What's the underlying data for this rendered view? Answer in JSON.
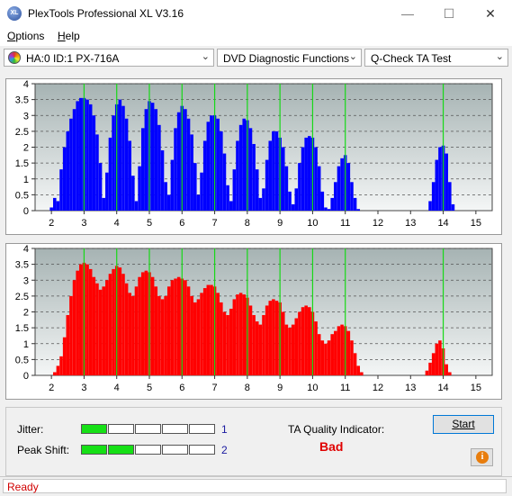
{
  "window": {
    "title": "PlexTools Professional XL V3.16",
    "icon_text": "XL",
    "minimize_glyph": "—",
    "maximize_glyph": "☐",
    "close_glyph": "✕"
  },
  "menu": [
    {
      "label": "Options",
      "accel": "O"
    },
    {
      "label": "Help",
      "accel": "H"
    }
  ],
  "toolbar": {
    "drive": "HA:0 ID:1  PX-716A",
    "function": "DVD Diagnostic Functions",
    "test": "Q-Check TA Test",
    "dropdown_glyph": "⌄"
  },
  "colors": {
    "top_series": "#0000ff",
    "bottom_series": "#ff0000",
    "marker": "#18d818",
    "status": "#d00000",
    "bad": "#e00000"
  },
  "chart_data": [
    {
      "type": "bar",
      "name": "top-chart",
      "xlim": [
        1.5,
        15.5
      ],
      "ylim": [
        0,
        4
      ],
      "x_ticks": [
        2,
        3,
        4,
        5,
        6,
        7,
        8,
        9,
        10,
        11,
        12,
        13,
        14,
        15
      ],
      "y_ticks": [
        0,
        0.5,
        1,
        1.5,
        2,
        2.5,
        3,
        3.5,
        4
      ],
      "y_tick_labels": [
        "0",
        "0.5",
        "1",
        "1.5",
        "2",
        "2.5",
        "3",
        "3.5",
        "4"
      ],
      "markers": [
        3,
        4,
        5,
        6,
        7,
        8,
        9,
        10,
        11,
        14
      ],
      "series": [
        {
          "color": "blue",
          "values": [
            [
              2.0,
              0.1
            ],
            [
              2.1,
              0.4
            ],
            [
              2.2,
              0.3
            ],
            [
              2.3,
              1.3
            ],
            [
              2.4,
              2.0
            ],
            [
              2.5,
              2.5
            ],
            [
              2.6,
              2.9
            ],
            [
              2.7,
              3.2
            ],
            [
              2.8,
              3.45
            ],
            [
              2.9,
              3.55
            ],
            [
              3.0,
              3.55
            ],
            [
              3.1,
              3.5
            ],
            [
              3.2,
              3.35
            ],
            [
              3.3,
              3.0
            ],
            [
              3.4,
              2.4
            ],
            [
              3.5,
              1.5
            ],
            [
              3.6,
              0.4
            ],
            [
              3.7,
              1.2
            ],
            [
              3.8,
              2.3
            ],
            [
              3.9,
              3.0
            ],
            [
              4.0,
              3.35
            ],
            [
              4.1,
              3.5
            ],
            [
              4.2,
              3.3
            ],
            [
              4.3,
              2.9
            ],
            [
              4.4,
              2.2
            ],
            [
              4.5,
              1.1
            ],
            [
              4.6,
              0.3
            ],
            [
              4.7,
              1.4
            ],
            [
              4.8,
              2.6
            ],
            [
              4.9,
              3.2
            ],
            [
              5.0,
              3.45
            ],
            [
              5.1,
              3.4
            ],
            [
              5.2,
              3.2
            ],
            [
              5.3,
              2.7
            ],
            [
              5.4,
              1.9
            ],
            [
              5.5,
              0.9
            ],
            [
              5.6,
              0.5
            ],
            [
              5.7,
              1.6
            ],
            [
              5.8,
              2.6
            ],
            [
              5.9,
              3.1
            ],
            [
              6.0,
              3.3
            ],
            [
              6.1,
              3.2
            ],
            [
              6.2,
              2.9
            ],
            [
              6.3,
              2.4
            ],
            [
              6.4,
              1.5
            ],
            [
              6.5,
              0.5
            ],
            [
              6.6,
              1.2
            ],
            [
              6.7,
              2.2
            ],
            [
              6.8,
              2.8
            ],
            [
              6.9,
              3.0
            ],
            [
              7.0,
              3.0
            ],
            [
              7.1,
              2.9
            ],
            [
              7.2,
              2.5
            ],
            [
              7.3,
              1.8
            ],
            [
              7.4,
              0.8
            ],
            [
              7.5,
              0.3
            ],
            [
              7.6,
              1.3
            ],
            [
              7.7,
              2.2
            ],
            [
              7.8,
              2.7
            ],
            [
              7.9,
              2.9
            ],
            [
              8.0,
              2.85
            ],
            [
              8.1,
              2.6
            ],
            [
              8.2,
              2.1
            ],
            [
              8.3,
              1.3
            ],
            [
              8.4,
              0.4
            ],
            [
              8.5,
              0.7
            ],
            [
              8.6,
              1.6
            ],
            [
              8.7,
              2.2
            ],
            [
              8.8,
              2.5
            ],
            [
              8.9,
              2.5
            ],
            [
              9.0,
              2.3
            ],
            [
              9.1,
              2.0
            ],
            [
              9.2,
              1.4
            ],
            [
              9.3,
              0.6
            ],
            [
              9.4,
              0.2
            ],
            [
              9.5,
              0.7
            ],
            [
              9.6,
              1.5
            ],
            [
              9.7,
              2.0
            ],
            [
              9.8,
              2.3
            ],
            [
              9.9,
              2.35
            ],
            [
              10.0,
              2.3
            ],
            [
              10.1,
              2.0
            ],
            [
              10.2,
              1.4
            ],
            [
              10.3,
              0.6
            ],
            [
              10.4,
              0.1
            ],
            [
              10.5,
              0.05
            ],
            [
              10.6,
              0.4
            ],
            [
              10.7,
              0.9
            ],
            [
              10.8,
              1.4
            ],
            [
              10.9,
              1.65
            ],
            [
              11.0,
              1.75
            ],
            [
              11.1,
              1.5
            ],
            [
              11.2,
              0.9
            ],
            [
              11.3,
              0.4
            ],
            [
              11.4,
              0.05
            ],
            [
              13.6,
              0.3
            ],
            [
              13.7,
              0.9
            ],
            [
              13.8,
              1.6
            ],
            [
              13.9,
              2.0
            ],
            [
              14.0,
              2.05
            ],
            [
              14.1,
              1.8
            ],
            [
              14.2,
              0.9
            ],
            [
              14.3,
              0.2
            ]
          ]
        }
      ]
    },
    {
      "type": "bar",
      "name": "bottom-chart",
      "xlim": [
        1.5,
        15.5
      ],
      "ylim": [
        0,
        4
      ],
      "x_ticks": [
        2,
        3,
        4,
        5,
        6,
        7,
        8,
        9,
        10,
        11,
        12,
        13,
        14,
        15
      ],
      "y_ticks": [
        0,
        0.5,
        1,
        1.5,
        2,
        2.5,
        3,
        3.5,
        4
      ],
      "y_tick_labels": [
        "0",
        "0.5",
        "1",
        "1.5",
        "2",
        "2.5",
        "3",
        "3.5",
        "4"
      ],
      "markers": [
        3,
        4,
        5,
        6,
        7,
        8,
        9,
        10,
        11,
        14
      ],
      "series": [
        {
          "color": "red",
          "values": [
            [
              2.1,
              0.1
            ],
            [
              2.2,
              0.3
            ],
            [
              2.3,
              0.6
            ],
            [
              2.4,
              1.2
            ],
            [
              2.5,
              1.9
            ],
            [
              2.6,
              2.5
            ],
            [
              2.7,
              3.0
            ],
            [
              2.8,
              3.3
            ],
            [
              2.9,
              3.5
            ],
            [
              3.0,
              3.55
            ],
            [
              3.1,
              3.5
            ],
            [
              3.2,
              3.35
            ],
            [
              3.3,
              3.1
            ],
            [
              3.4,
              2.9
            ],
            [
              3.5,
              2.7
            ],
            [
              3.6,
              2.8
            ],
            [
              3.7,
              3.0
            ],
            [
              3.8,
              3.2
            ],
            [
              3.9,
              3.35
            ],
            [
              4.0,
              3.45
            ],
            [
              4.1,
              3.4
            ],
            [
              4.2,
              3.2
            ],
            [
              4.3,
              2.9
            ],
            [
              4.4,
              2.6
            ],
            [
              4.5,
              2.5
            ],
            [
              4.6,
              2.8
            ],
            [
              4.7,
              3.1
            ],
            [
              4.8,
              3.25
            ],
            [
              4.9,
              3.3
            ],
            [
              5.0,
              3.25
            ],
            [
              5.1,
              3.1
            ],
            [
              5.2,
              2.8
            ],
            [
              5.3,
              2.5
            ],
            [
              5.4,
              2.4
            ],
            [
              5.5,
              2.5
            ],
            [
              5.6,
              2.8
            ],
            [
              5.7,
              3.0
            ],
            [
              5.8,
              3.05
            ],
            [
              5.9,
              3.1
            ],
            [
              6.0,
              3.05
            ],
            [
              6.1,
              3.0
            ],
            [
              6.2,
              2.8
            ],
            [
              6.3,
              2.5
            ],
            [
              6.4,
              2.3
            ],
            [
              6.5,
              2.4
            ],
            [
              6.6,
              2.6
            ],
            [
              6.7,
              2.75
            ],
            [
              6.8,
              2.85
            ],
            [
              6.9,
              2.85
            ],
            [
              7.0,
              2.8
            ],
            [
              7.1,
              2.6
            ],
            [
              7.2,
              2.3
            ],
            [
              7.3,
              2.0
            ],
            [
              7.4,
              1.9
            ],
            [
              7.5,
              2.1
            ],
            [
              7.6,
              2.4
            ],
            [
              7.7,
              2.55
            ],
            [
              7.8,
              2.6
            ],
            [
              7.9,
              2.55
            ],
            [
              8.0,
              2.45
            ],
            [
              8.1,
              2.2
            ],
            [
              8.2,
              1.9
            ],
            [
              8.3,
              1.7
            ],
            [
              8.4,
              1.6
            ],
            [
              8.5,
              1.9
            ],
            [
              8.6,
              2.2
            ],
            [
              8.7,
              2.35
            ],
            [
              8.8,
              2.4
            ],
            [
              8.9,
              2.35
            ],
            [
              9.0,
              2.3
            ],
            [
              9.1,
              2.0
            ],
            [
              9.2,
              1.6
            ],
            [
              9.3,
              1.5
            ],
            [
              9.4,
              1.6
            ],
            [
              9.5,
              1.8
            ],
            [
              9.6,
              2.0
            ],
            [
              9.7,
              2.15
            ],
            [
              9.8,
              2.2
            ],
            [
              9.9,
              2.15
            ],
            [
              10.0,
              2.0
            ],
            [
              10.1,
              1.7
            ],
            [
              10.2,
              1.3
            ],
            [
              10.3,
              1.1
            ],
            [
              10.4,
              1.0
            ],
            [
              10.5,
              1.1
            ],
            [
              10.6,
              1.3
            ],
            [
              10.7,
              1.4
            ],
            [
              10.8,
              1.55
            ],
            [
              10.9,
              1.6
            ],
            [
              11.0,
              1.55
            ],
            [
              11.1,
              1.4
            ],
            [
              11.2,
              1.1
            ],
            [
              11.3,
              0.7
            ],
            [
              11.4,
              0.3
            ],
            [
              11.5,
              0.1
            ],
            [
              13.5,
              0.15
            ],
            [
              13.6,
              0.4
            ],
            [
              13.7,
              0.7
            ],
            [
              13.8,
              1.0
            ],
            [
              13.9,
              1.1
            ],
            [
              14.0,
              0.85
            ],
            [
              14.1,
              0.35
            ],
            [
              14.2,
              0.1
            ]
          ]
        }
      ]
    }
  ],
  "results": {
    "jitter_label": "Jitter:",
    "jitter_value": "1",
    "jitter_level": 1,
    "peak_shift_label": "Peak Shift:",
    "peak_shift_value": "2",
    "peak_shift_level": 2,
    "segments": 5,
    "ta_label": "TA Quality Indicator:",
    "ta_value": "Bad"
  },
  "buttons": {
    "start": "Start",
    "start_accel": "S",
    "info_glyph": "i"
  },
  "status": {
    "text": "Ready"
  }
}
